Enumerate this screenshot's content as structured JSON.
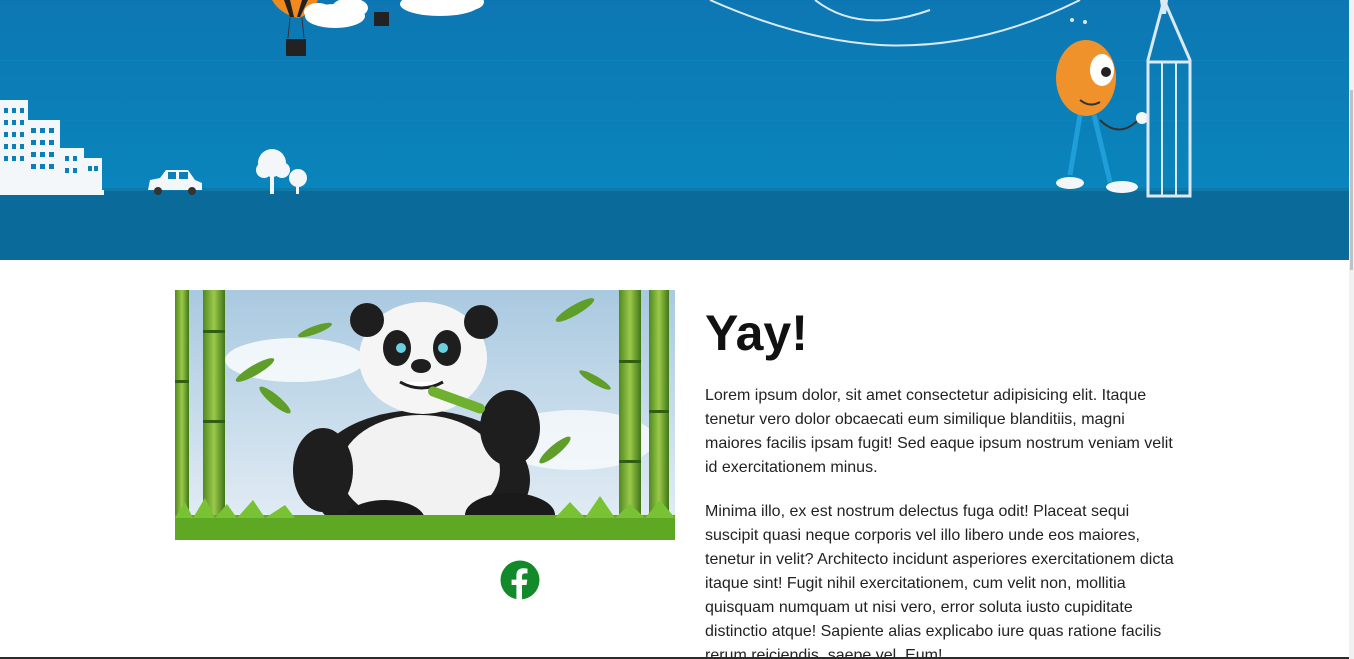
{
  "banner": {
    "scene": "illustrated city skyline with balloon, clouds, car, trees and a mascot holding a pencil",
    "colors": {
      "sky": "#0b80b8",
      "ground": "#0a6a99"
    }
  },
  "media": {
    "panda_alt": "Panda eating bamboo",
    "facebook_icon": "facebook-icon",
    "facebook_color": "#1a8a2b"
  },
  "article": {
    "heading": "Yay!",
    "paragraphs": [
      "Lorem ipsum dolor, sit amet consectetur adipisicing elit. Itaque tenetur vero dolor obcaecati eum similique blanditiis, magni maiores facilis ipsam fugit! Sed eaque ipsum nostrum veniam velit id exercitationem minus.",
      "Minima illo, ex est nostrum delectus fuga odit! Placeat sequi suscipit quasi neque corporis vel illo libero unde eos maiores, tenetur in velit? Architecto incidunt asperiores exercitationem dicta itaque sint! Fugit nihil exercitationem, cum velit non, mollitia quisquam numquam ut nisi vero, error soluta iusto cupiditate distinctio atque! Sapiente alias explicabo iure quas ratione facilis rerum reiciendis, saepe vel. Eum!"
    ]
  }
}
